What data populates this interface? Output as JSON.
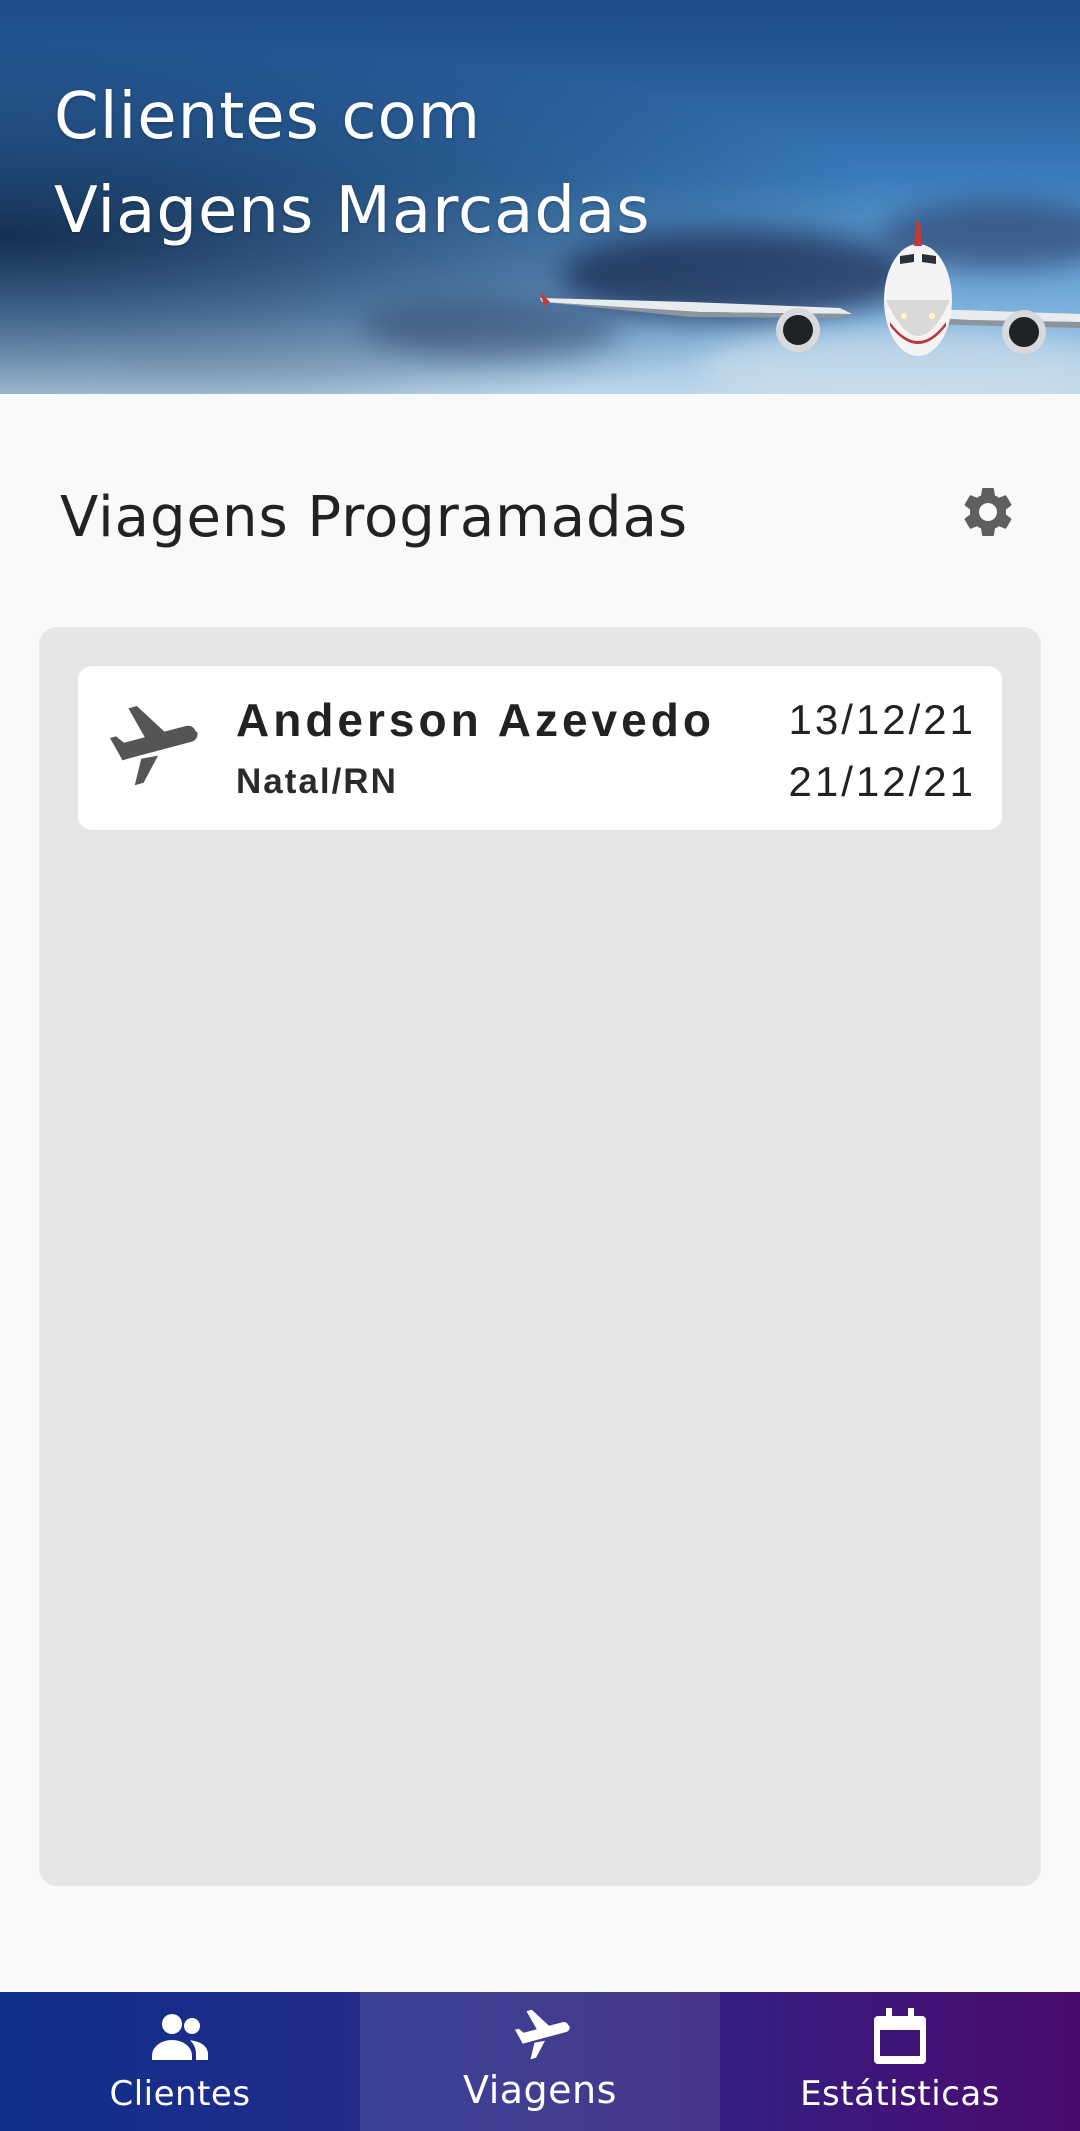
{
  "header": {
    "title_line1": "Clientes com",
    "title_line2": "Viagens Marcadas"
  },
  "section": {
    "title": "Viagens Programadas",
    "settings_icon": "gear-icon"
  },
  "trips": [
    {
      "client_name": "Anderson Azevedo",
      "destination": "Natal/RN",
      "start_date": "13/12/21",
      "end_date": "21/12/21",
      "icon": "airplane-icon"
    }
  ],
  "nav": {
    "items": [
      {
        "label": "Clientes",
        "icon": "people-icon",
        "active": false
      },
      {
        "label": "Viagens",
        "icon": "airplane-icon",
        "active": true
      },
      {
        "label": "Estátisticas",
        "icon": "calendar-icon",
        "active": false
      }
    ]
  },
  "colors": {
    "background": "#f9f9f9",
    "panel": "#e6e6e6",
    "card": "#ffffff",
    "icon_gray": "#5f5f5f",
    "nav_gradient_start": "#0f2f8c",
    "nav_gradient_end": "#4b0a6e"
  }
}
